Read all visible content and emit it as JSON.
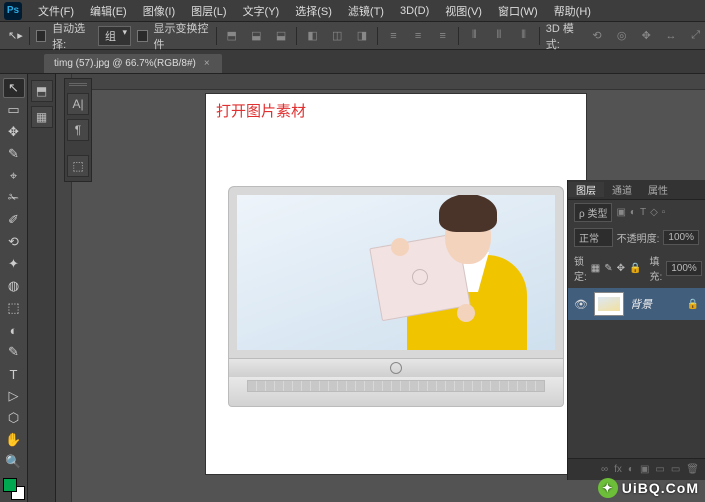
{
  "app": {
    "logo": "Ps"
  },
  "menu": {
    "items": [
      "文件(F)",
      "编辑(E)",
      "图像(I)",
      "图层(L)",
      "文字(Y)",
      "选择(S)",
      "滤镜(T)",
      "3D(D)",
      "视图(V)",
      "窗口(W)",
      "帮助(H)"
    ]
  },
  "options": {
    "auto_select": "自动选择:",
    "group": "组",
    "show_transform": "显示变换控件",
    "mode3d_label": "3D 模式:"
  },
  "tab": {
    "title": "timg (57).jpg @ 66.7%(RGB/8#)",
    "close": "×"
  },
  "annotation": "打开图片素材",
  "layers_panel": {
    "tabs": [
      "图层",
      "通道",
      "属性"
    ],
    "kind_label": "ρ 类型",
    "blend_mode": "正常",
    "opacity_label": "不透明度:",
    "opacity_value": "100%",
    "lock_label": "锁定:",
    "fill_label": "填充:",
    "fill_value": "100%",
    "layer0_name": "背景",
    "footer_icons": [
      "∞",
      "fx",
      "◐",
      "▣",
      "▭",
      "🗑"
    ]
  },
  "tools": {
    "icons": [
      "↖",
      "▭",
      "✥",
      "✎",
      "⌖",
      "✁",
      "✐",
      "⟲",
      "✦",
      "◍",
      "⬚",
      "◐",
      "✎",
      "T",
      "▷",
      "⬡",
      "✋",
      "🔍"
    ]
  },
  "mini": {
    "btns": [
      "⬒",
      "▦"
    ]
  },
  "side": {
    "btns": [
      "A|",
      "¶",
      "⬚"
    ]
  },
  "watermark": "UiBQ.CoM"
}
